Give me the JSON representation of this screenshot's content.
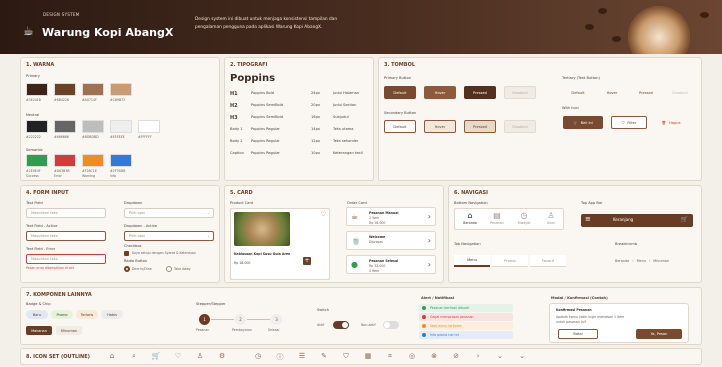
{
  "header": {
    "tag": "DESIGN SYSTEM",
    "brand": "Warung Kopi AbangX",
    "description": "Design system ini dibuat untuk menjaga konsistensi tampilan dan pengalaman pengguna pada aplikasi Warung Kopi AbangX."
  },
  "colors": {
    "title": "1. WARNA",
    "primary_label": "Primary",
    "neutral_label": "Neutral",
    "semantic_label": "Semantic",
    "primary": [
      {
        "hex": "#3E2418",
        "code": "#3E2418"
      },
      {
        "hex": "#6B4226",
        "code": "#6B4226"
      },
      {
        "hex": "#A0714F",
        "code": "#A0714F"
      },
      {
        "hex": "#C89B72",
        "code": "#C89B72"
      }
    ],
    "neutral": [
      {
        "hex": "#222222",
        "code": "#222222"
      },
      {
        "hex": "#666666",
        "code": "#666666"
      },
      {
        "hex": "#BDBDBD",
        "code": "#BDBDBD"
      },
      {
        "hex": "#EEEEEE",
        "code": "#EEEEEE"
      },
      {
        "hex": "#FFFFFF",
        "code": "#FFFFFF"
      }
    ],
    "semantic": [
      {
        "hex": "#2E9E4F",
        "code": "#2E9E4F",
        "name": "Success"
      },
      {
        "hex": "#D63B3B",
        "code": "#D63B3B",
        "name": "Error"
      },
      {
        "hex": "#F28C1E",
        "code": "#F28C1E",
        "name": "Warning"
      },
      {
        "hex": "#2F7BDB",
        "code": "#2F7BDB",
        "name": "Info"
      }
    ]
  },
  "typography": {
    "title": "2. TIPOGRAFI",
    "font": "Poppins",
    "rows": [
      {
        "name": "H1",
        "desc": "Poppins Bold",
        "size": "24px",
        "use": "Judul Halaman"
      },
      {
        "name": "H2",
        "desc": "Poppins SemiBold",
        "size": "20px",
        "use": "Judul Section"
      },
      {
        "name": "H3",
        "desc": "Poppins SemiBold",
        "size": "16px",
        "use": "Subjudul"
      },
      {
        "name": "Body 1",
        "desc": "Poppins Regular",
        "size": "14px",
        "use": "Teks utama"
      },
      {
        "name": "Body 2",
        "desc": "Poppins Regular",
        "size": "12px",
        "use": "Teks sekunder"
      },
      {
        "name": "Caption",
        "desc": "Poppins Regular",
        "size": "10px",
        "use": "Keterangan kecil"
      }
    ]
  },
  "buttons": {
    "title": "3. TOMBOL",
    "primary_label": "Primary Button",
    "secondary_label": "Secondary Button",
    "tertiary_label": "Tertiary (Text Button)",
    "icon_label": "With Icon",
    "states": [
      "Default",
      "Hover",
      "Pressed",
      "Disabled"
    ],
    "icon_buttons": [
      "Beli Ini",
      "Filter",
      "Hapus"
    ]
  },
  "form": {
    "title": "4. FORM INPUT",
    "text_field": "Text Field",
    "text_active": "Text Field - Active",
    "text_error": "Text Field - Error",
    "placeholder": "Masukkan teks",
    "error_msg": "Pesan error ditampilkan di sini",
    "dropdown": "Dropdown",
    "dropdown_active": "Dropdown - Active",
    "dropdown_placeholder": "Pilih opsi",
    "checkbox_label": "Checkbox",
    "checkbox_text": "Saya setuju dengan Syarat & Ketentuan",
    "radio_label": "Radio Button",
    "radio_options": [
      "Dine In/Dine",
      "Take Away"
    ]
  },
  "card": {
    "title": "5. CARD",
    "product_label": "Product Card",
    "product_name": "Kebiasaan Kopi Susu Gula Aren",
    "price": "Rp 18.000",
    "order_label": "Order Card",
    "orders": [
      {
        "name": "Pesanan Manual",
        "sub": "2 item",
        "price": "Rp 18.000"
      },
      {
        "name": "Welcome",
        "sub": "Diproses",
        "price": ""
      },
      {
        "name": "Pesanan Selesai",
        "sub": "Rp 32.000",
        "price": "4 item"
      }
    ]
  },
  "nav": {
    "title": "6. NAVIGASI",
    "bottom_label": "Bottom Navigation",
    "items": [
      "Beranda",
      "Pesanan",
      "Riwayat",
      "Akun"
    ],
    "topbar_label": "Top App Bar",
    "topbar_title": "Keranjang",
    "tab_label": "Tab Navigation",
    "tabs": [
      "Menu",
      "Promo",
      "Favorit"
    ],
    "bc_label": "Breadcrumb",
    "breadcrumb": [
      "Beranda",
      "Menu",
      "Minuman"
    ]
  },
  "other": {
    "title": "7. KOMPONEN LAINNYA",
    "badge_label": "Badge & Chip",
    "chips": [
      "Baru",
      "Promo",
      "Terlaris",
      "Habis"
    ],
    "chips2": [
      "Makanan",
      "Minuman"
    ],
    "stepper_label": "Stepper/Stepper",
    "steps": [
      {
        "n": "1",
        "label": "Pesanan"
      },
      {
        "n": "2",
        "label": "Pembayaran"
      },
      {
        "n": "3",
        "label": "Selesai"
      }
    ],
    "switch_label": "Switch",
    "switch_on": "Aktif",
    "switch_off": "Non-aktif",
    "alert_label": "Alert / Notifikasi",
    "alerts": [
      {
        "text": "Pesanan berhasil dibuat!",
        "color": "#2E9E4F",
        "bg": "#e4f3e8"
      },
      {
        "text": "Gagal memproses pesanan",
        "color": "#D63B3B",
        "bg": "#f8e3e3"
      },
      {
        "text": "Stok menu terbatas",
        "color": "#F28C1E",
        "bg": "#fcefdf"
      },
      {
        "text": "Info promo hari ini",
        "color": "#2F7BDB",
        "bg": "#e3edf9"
      }
    ],
    "modal_label": "Modal / Konfirmasi (Contoh)",
    "modal_title": "Konfirmasi Pesanan",
    "modal_text": "Apakah kamu yakin ingin memesan 1 item untuk pesanan ini?",
    "modal_cancel": "Batal",
    "modal_ok": "Ya, Pesan"
  },
  "icons": {
    "title": "8. ICON SET (OUTLINE)"
  }
}
